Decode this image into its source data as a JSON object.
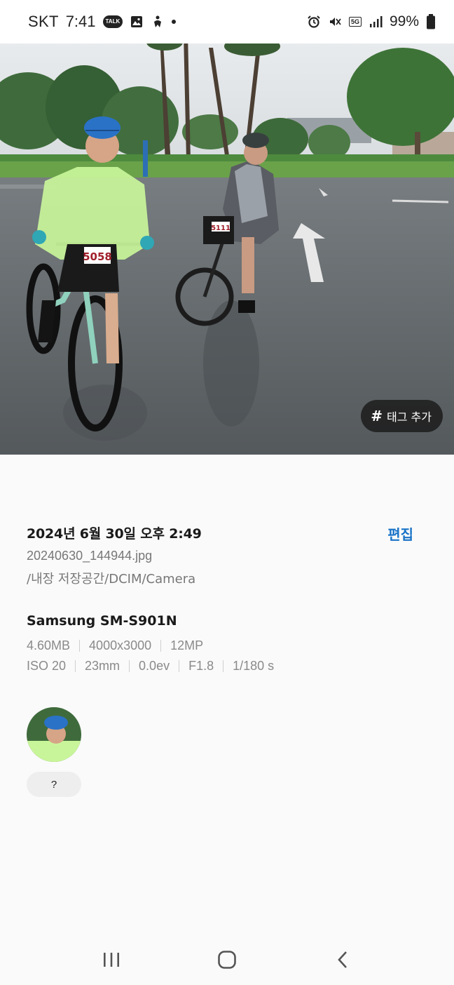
{
  "status_bar": {
    "carrier": "SKT",
    "time": "7:41",
    "talk_badge": "TALK",
    "network_badge": "5G",
    "battery_percent": "99%",
    "icons": [
      "talk-icon",
      "gallery-icon",
      "accessibility-icon",
      "dot-icon",
      "alarm-icon",
      "mute-icon",
      "5g-icon",
      "signal-icon",
      "battery-icon"
    ]
  },
  "photo": {
    "bib_left": "5058",
    "bib_right": "5111"
  },
  "tag_button": {
    "icon": "#",
    "label": "태그 추가"
  },
  "info": {
    "datetime": "2024년 6월 30일 오후 2:49",
    "edit_label": "편집",
    "filename": "20240630_144944.jpg",
    "path": "/내장 저장공간/DCIM/Camera",
    "device": "Samsung SM-S901N",
    "specs_row1": [
      "4.60MB",
      "4000x3000",
      "12MP"
    ],
    "specs_row2": [
      "ISO 20",
      "23mm",
      "0.0ev",
      "F1.8",
      "1/180 s"
    ]
  },
  "people": {
    "face_label": "?"
  },
  "nav_bar": {
    "buttons": [
      "recent-apps",
      "home",
      "back"
    ]
  },
  "colors": {
    "accent": "#1a73c8",
    "background": "#fafafa"
  }
}
